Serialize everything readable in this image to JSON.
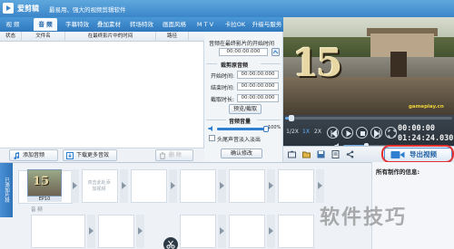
{
  "window": {
    "app_name": "爱剪辑",
    "slogan": "最易用、强大的视频剪辑软件"
  },
  "tabs": [
    {
      "label": "视 频"
    },
    {
      "label": "音 频"
    },
    {
      "label": "字幕特效"
    },
    {
      "label": "叠加素材"
    },
    {
      "label": "转场特效"
    },
    {
      "label": "画面风格"
    },
    {
      "label": "M T V"
    },
    {
      "label": "卡拉OK"
    },
    {
      "label": "升级与服务"
    }
  ],
  "active_tab": "音 频",
  "audio_table": {
    "columns": [
      "状态",
      "文件名",
      "在最终影片中的时间",
      "路径"
    ],
    "rows": []
  },
  "left_buttons": {
    "add_audio": "添加音频",
    "download_more": "下载更多音效",
    "delete": "删 除"
  },
  "audio_settings": {
    "start_time_label": "音频在最终影片的开始时间",
    "start_time_value": "00:00:00.000",
    "clip_section_title": "裁剪原音频",
    "start_label": "开始时间:",
    "start_value": "00:00:00.000",
    "end_label": "结束时间:",
    "end_value": "00:00:00.000",
    "duration_label": "截取时长:",
    "duration_value": "00:00:00.000",
    "preview_button": "预览/截取",
    "volume_title": "音频音量",
    "volume_percent": "100%",
    "volume_level": 1.0,
    "fade_label": "头尾声音淡入淡出",
    "fade_checked": false,
    "confirm_button": "确认修改"
  },
  "preview": {
    "overlay_number": "15",
    "watermark_text": "gameplay.cn"
  },
  "player": {
    "speeds": [
      "1/2X",
      "1X",
      "2X"
    ],
    "active_speed": "1X",
    "time_current": "00:00:00",
    "time_total": "01:24:24.030",
    "seek_progress": 0.04,
    "volume_level": 0.45
  },
  "toolbar": {
    "export_button": "导出视频"
  },
  "info_panel": {
    "title": "所有制作的信息:"
  },
  "timeline": {
    "side_label": "已添加片段",
    "clip_caption": "EP10",
    "clip_number": "15",
    "transition_hint": "双击此处添加视频",
    "subtitle_row_label": "音 频"
  },
  "watermark": "软件技巧",
  "colors": {
    "title_bar": "#3b86c9",
    "active_tab_text": "#1a5fa6",
    "export_accent": "#1f5fa3",
    "highlight": "#e53030"
  }
}
